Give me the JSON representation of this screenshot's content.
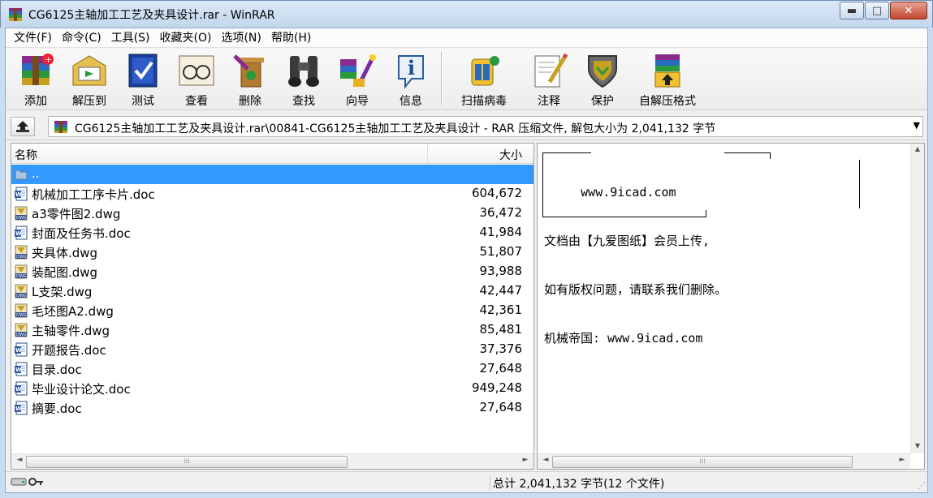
{
  "window": {
    "title": "CG6125主轴加工工艺及夹具设计.rar - WinRAR",
    "minimize_glyph": "▬",
    "maximize_glyph": "□",
    "close_glyph": "✕"
  },
  "menu": [
    "文件(F)",
    "命令(C)",
    "工具(S)",
    "收藏夹(O)",
    "选项(N)",
    "帮助(H)"
  ],
  "toolbar": {
    "group1": [
      {
        "label": "添加",
        "icon": "add-icon"
      },
      {
        "label": "解压到",
        "icon": "extract-icon"
      },
      {
        "label": "测试",
        "icon": "test-icon"
      },
      {
        "label": "查看",
        "icon": "view-icon"
      },
      {
        "label": "删除",
        "icon": "delete-icon"
      },
      {
        "label": "查找",
        "icon": "find-icon"
      },
      {
        "label": "向导",
        "icon": "wizard-icon"
      },
      {
        "label": "信息",
        "icon": "info-icon"
      }
    ],
    "group2": [
      {
        "label": "扫描病毒",
        "icon": "virus-scan-icon"
      },
      {
        "label": "注释",
        "icon": "comment-icon"
      },
      {
        "label": "保护",
        "icon": "protect-icon"
      },
      {
        "label": "自解压格式",
        "icon": "sfx-icon"
      }
    ]
  },
  "address": {
    "path": "CG6125主轴加工工艺及夹具设计.rar\\00841-CG6125主轴加工工艺及夹具设计 - RAR 压缩文件, 解包大小为 2,041,132 字节",
    "dropdown_glyph": "▼"
  },
  "file_list": {
    "columns": {
      "name": "名称",
      "size": "大小"
    },
    "rows": [
      {
        "name": "..",
        "size": "",
        "type": "folder",
        "selected": true
      },
      {
        "name": "机械加工工序卡片.doc",
        "size": "604,672",
        "type": "doc"
      },
      {
        "name": "a3零件图2.dwg",
        "size": "36,472",
        "type": "dwg"
      },
      {
        "name": "封面及任务书.doc",
        "size": "41,984",
        "type": "doc"
      },
      {
        "name": "夹具体.dwg",
        "size": "51,807",
        "type": "dwg"
      },
      {
        "name": "装配图.dwg",
        "size": "93,988",
        "type": "dwg"
      },
      {
        "name": "L支架.dwg",
        "size": "42,447",
        "type": "dwg"
      },
      {
        "name": "毛坯图A2.dwg",
        "size": "42,361",
        "type": "dwg"
      },
      {
        "name": "主轴零件.dwg",
        "size": "85,481",
        "type": "dwg"
      },
      {
        "name": "开题报告.doc",
        "size": "37,376",
        "type": "doc"
      },
      {
        "name": "目录.doc",
        "size": "27,648",
        "type": "doc"
      },
      {
        "name": "毕业设计论文.doc",
        "size": "949,248",
        "type": "doc"
      },
      {
        "name": "摘要.doc",
        "size": "27,648",
        "type": "doc"
      }
    ]
  },
  "comment": {
    "lines": [
      "     www.9icad.com",
      "文档由【九爱图纸】会员上传,",
      "如有版权问题，请联系我们删除。",
      "机械帝国: www.9icad.com"
    ]
  },
  "status": {
    "text": "总计 2,041,132 字节(12 个文件)"
  },
  "colors": {
    "selection": "#3399ff",
    "titlebar": "#c3d6ec"
  }
}
